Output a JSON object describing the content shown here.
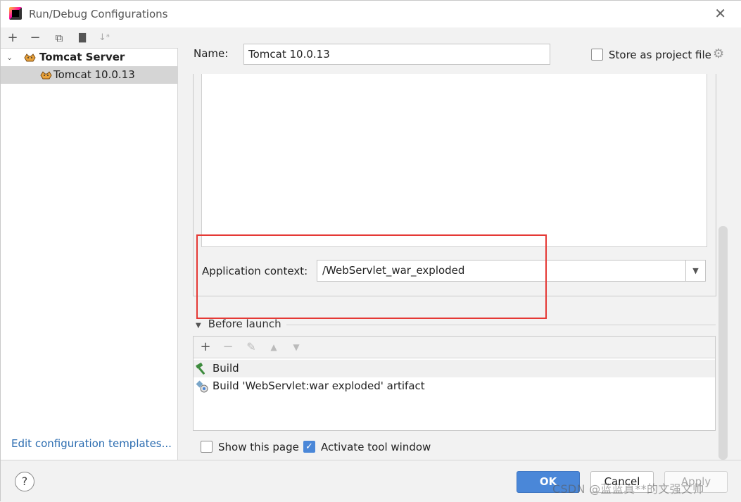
{
  "window": {
    "title": "Run/Debug Configurations",
    "close_glyph": "✕"
  },
  "left_toolbar": {
    "add": "+",
    "remove": "−",
    "copy": "⧉",
    "folder": "▇",
    "sort": "↓ᵃ"
  },
  "tree": {
    "group_label": "Tomcat Server",
    "item_label": "Tomcat 10.0.13",
    "chevron": "⌄"
  },
  "edit_templates_link": "Edit configuration templates...",
  "form": {
    "name_label": "Name:",
    "name_value": "Tomcat 10.0.13",
    "store_label": "Store as project file",
    "store_checked": false,
    "gear_glyph": "⚙",
    "app_context_label": "Application context:",
    "app_context_value": "/WebServlet_war_exploded",
    "dropdown_glyph": "▼"
  },
  "before_launch": {
    "header": "Before launch",
    "toolbar": {
      "add": "+",
      "remove": "−",
      "edit": "✎",
      "up": "▲",
      "down": "▼"
    },
    "items": [
      {
        "label": "Build",
        "icon": "hammer-icon"
      },
      {
        "label": "Build 'WebServlet:war exploded' artifact",
        "icon": "artifact-icon"
      }
    ]
  },
  "options": {
    "show_page_label": "Show this page",
    "show_page_checked": false,
    "activate_label": "Activate tool window",
    "activate_checked": true,
    "check_glyph": "✓"
  },
  "buttons": {
    "help": "?",
    "ok": "OK",
    "cancel": "Cancel",
    "apply": "Apply"
  },
  "watermark": "CSDN @蓝蓝真**的文强文帅",
  "colors": {
    "highlight_red": "#e53935",
    "accent_blue": "#4a87d8",
    "link_blue": "#2b6cb0"
  }
}
